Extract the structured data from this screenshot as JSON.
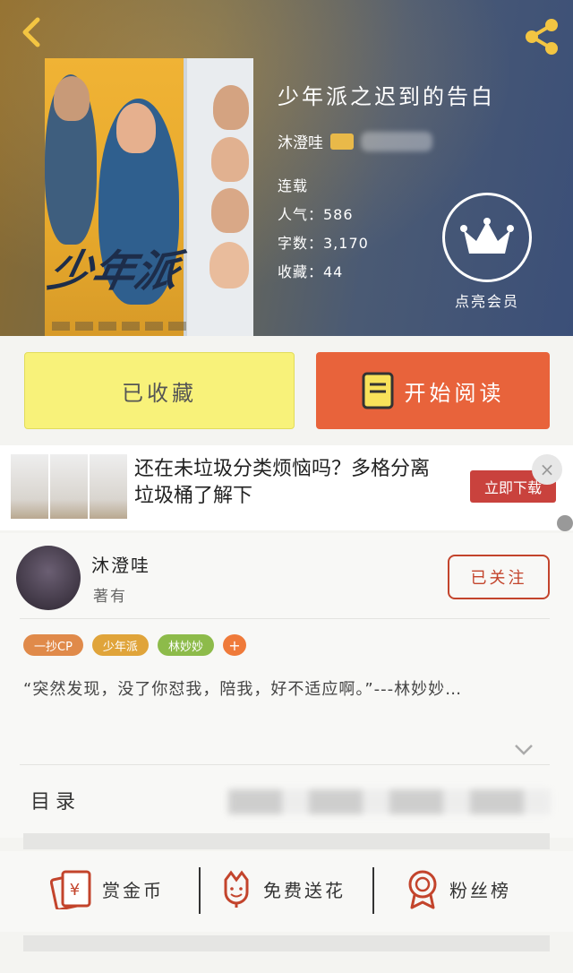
{
  "header": {
    "book_title": "少年派之迟到的告白",
    "author": "沐澄哇",
    "status": "连载",
    "popularity": "人气：586",
    "word_count": "字数：3,170",
    "favorites": "收藏：44",
    "vip_label": "点亮会员",
    "cover_logo": "少年派"
  },
  "actions": {
    "favorite_label": "已收藏",
    "read_label": "开始阅读"
  },
  "ad": {
    "text": "还在未垃圾分类烦恼吗？多格分离垃圾桶了解下",
    "button": "立即下载",
    "close": "×"
  },
  "author_card": {
    "name": "沐澄哇",
    "works": "著有",
    "follow_label": "已关注",
    "tags": [
      {
        "label": "一抄CP",
        "color": "#e08a4a"
      },
      {
        "label": "少年派",
        "color": "#e0a43a"
      },
      {
        "label": "林妙妙",
        "color": "#8dbb4a"
      },
      {
        "label": "+",
        "color": "#ef7a3a"
      }
    ],
    "quote": "“突然发现，没了你怼我，陪我，好不适应啊。”---林妙妙…"
  },
  "toc": {
    "label": "目录"
  },
  "bottom": {
    "reward": "赏金币",
    "flower": "免费送花",
    "fans": "粉丝榜"
  },
  "colors": {
    "accent": "#e8633b",
    "favorite_bg": "#f8f27a",
    "icon_red": "#c3442c"
  }
}
